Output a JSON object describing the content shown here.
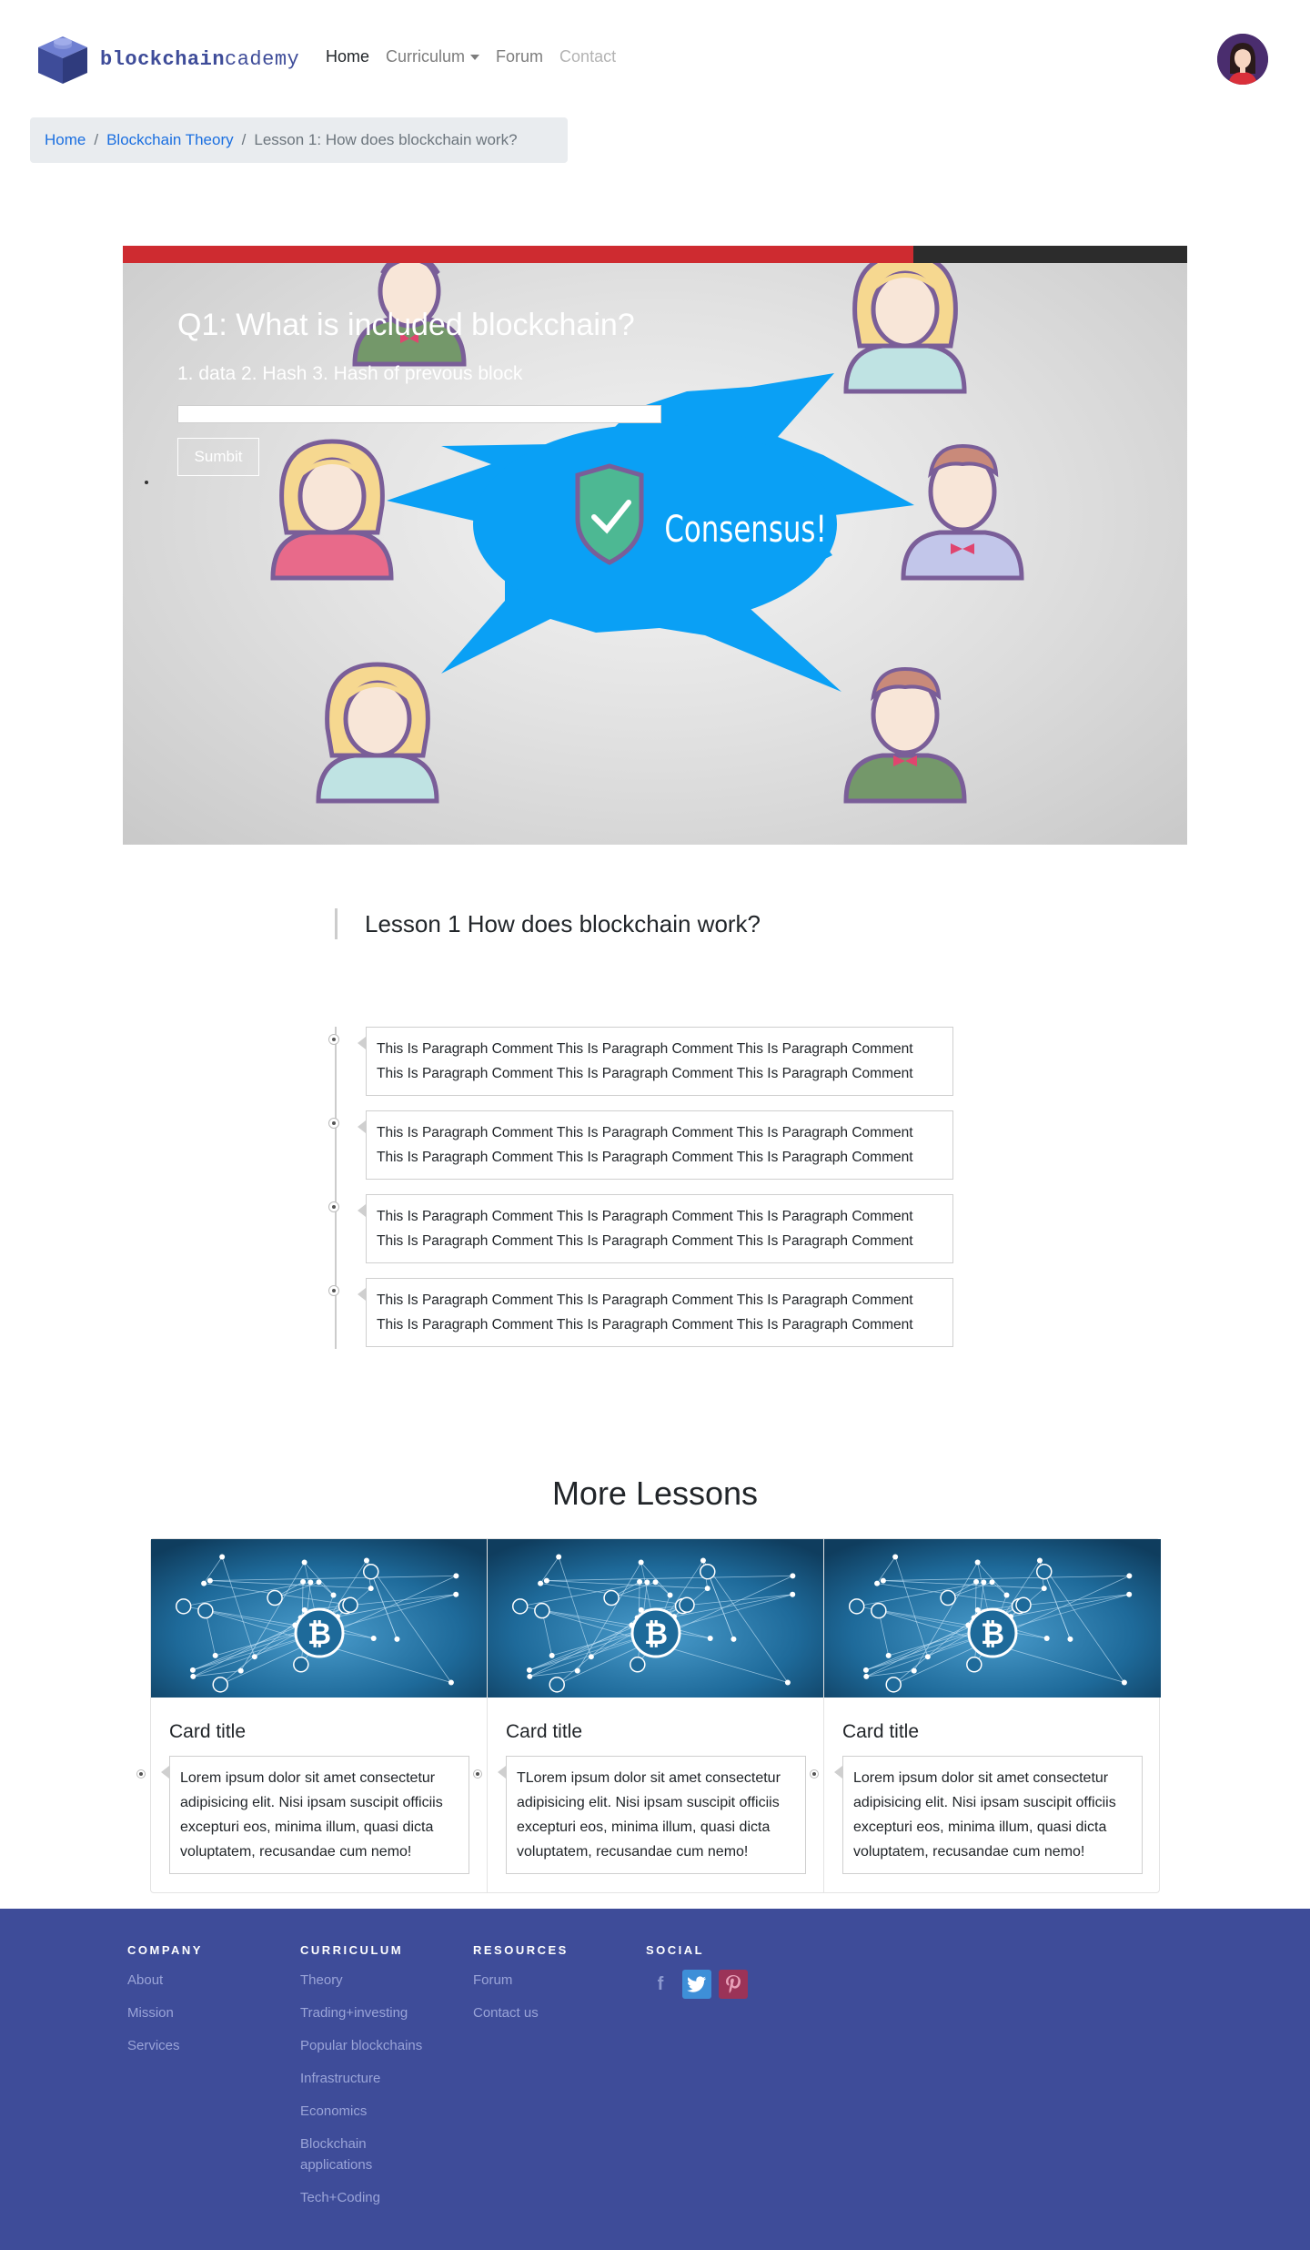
{
  "brand": {
    "name_bold": "blockchain",
    "name_rest": "cademy"
  },
  "nav": {
    "home": "Home",
    "curriculum": "Curriculum",
    "forum": "Forum",
    "contact": "Contact"
  },
  "breadcrumb": {
    "home": "Home",
    "section": "Blockchain Theory",
    "current": "Lesson 1: How does blockchain work?"
  },
  "hero": {
    "progress_fraction": 0.743,
    "question": "Q1: What is included blockchain?",
    "hint": "1. data 2. Hash 3. Hash of prevous block",
    "input_value": "",
    "submit_label": "Sumbit",
    "banner_text": "Consensus!",
    "colors": {
      "progress": "#ce2b30",
      "track": "#2c2c2c",
      "burst": "#0aa0f5"
    }
  },
  "lesson": {
    "title": "Lesson 1 How does blockchain work?",
    "comments": [
      "This Is Paragraph Comment This Is Paragraph Comment This Is Paragraph Comment This Is Paragraph Comment This Is Paragraph Comment This Is Paragraph Comment",
      "This Is Paragraph Comment This Is Paragraph Comment This Is Paragraph Comment This Is Paragraph Comment This Is Paragraph Comment This Is Paragraph Comment",
      "This Is Paragraph Comment This Is Paragraph Comment This Is Paragraph Comment This Is Paragraph Comment This Is Paragraph Comment This Is Paragraph Comment",
      "This Is Paragraph Comment This Is Paragraph Comment This Is Paragraph Comment This Is Paragraph Comment This Is Paragraph Comment This Is Paragraph Comment"
    ]
  },
  "more_lessons": {
    "heading": "More Lessons",
    "cards": [
      {
        "title": "Card title",
        "text": "Lorem ipsum dolor sit amet consectetur adipisicing elit. Nisi ipsam suscipit officiis excepturi eos, minima illum, quasi dicta voluptatem, recusandae cum nemo!"
      },
      {
        "title": "Card title",
        "text": "TLorem ipsum dolor sit amet consectetur adipisicing elit. Nisi ipsam suscipit officiis excepturi eos, minima illum, quasi dicta voluptatem, recusandae cum nemo!"
      },
      {
        "title": "Card title",
        "text": "Lorem ipsum dolor sit amet consectetur adipisicing elit. Nisi ipsam suscipit officiis excepturi eos, minima illum, quasi dicta voluptatem, recusandae cum nemo!"
      }
    ]
  },
  "footer": {
    "company": {
      "heading": "COMPANY",
      "links": [
        "About",
        "Mission",
        "Services"
      ]
    },
    "curriculum": {
      "heading": "CURRICULUM",
      "links": [
        "Theory",
        "Trading+investing",
        "Popular blockchains",
        "Infrastructure",
        "Economics",
        "Blockchain applications",
        "Tech+Coding"
      ]
    },
    "resources": {
      "heading": "RESOURCES",
      "links": [
        "Forum",
        "Contact us"
      ]
    },
    "social": {
      "heading": "SOCIAL",
      "icons": [
        "facebook-icon",
        "twitter-icon",
        "pinterest-icon"
      ]
    },
    "background": "#3e4c99"
  }
}
